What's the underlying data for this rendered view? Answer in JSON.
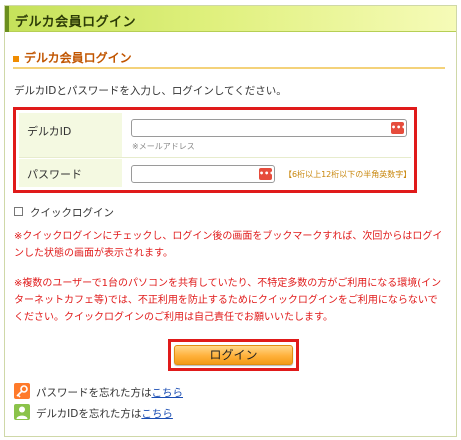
{
  "header": {
    "title": "デルカ会員ログイン"
  },
  "section": {
    "title": "デルカ会員ログイン"
  },
  "intro": "デルカIDとパスワードを入力し、ログインしてください。",
  "form": {
    "id_label": "デルカID",
    "id_value": "",
    "id_hint": "※メールアドレス",
    "password_label": "パスワード",
    "password_value": "",
    "password_hint": "【6桁以上12桁以下の半角英数字】",
    "field_icon": "•••"
  },
  "quick_login": {
    "label": "クイックログイン",
    "checked": false
  },
  "notices": [
    "※クイックログインにチェックし、ログイン後の画面をブックマークすれば、次回からはログインした状態の画面が表示されます。",
    "※複数のユーザーで1台のパソコンを共有していたり、不特定多数の方がご利用になる環境(インターネットカフェ等)では、不正利用を防止するためにクイックログインをご利用にならないでください。クイックログインのご利用は自己責任でお願いいたします。"
  ],
  "login_button": "ログイン",
  "links": {
    "forgot_password_text": "パスワードを忘れた方は",
    "forgot_password_link": "こちら",
    "forgot_id_text": "デルカIDを忘れた方は",
    "forgot_id_link": "こちら"
  },
  "colors": {
    "accent": "#e01a1a",
    "header_green": "#c5e15a",
    "button_orange": "#ffb13b",
    "link": "#1a4db3"
  },
  "icons": {
    "password_link_icon": "key-icon",
    "id_link_icon": "user-icon"
  }
}
